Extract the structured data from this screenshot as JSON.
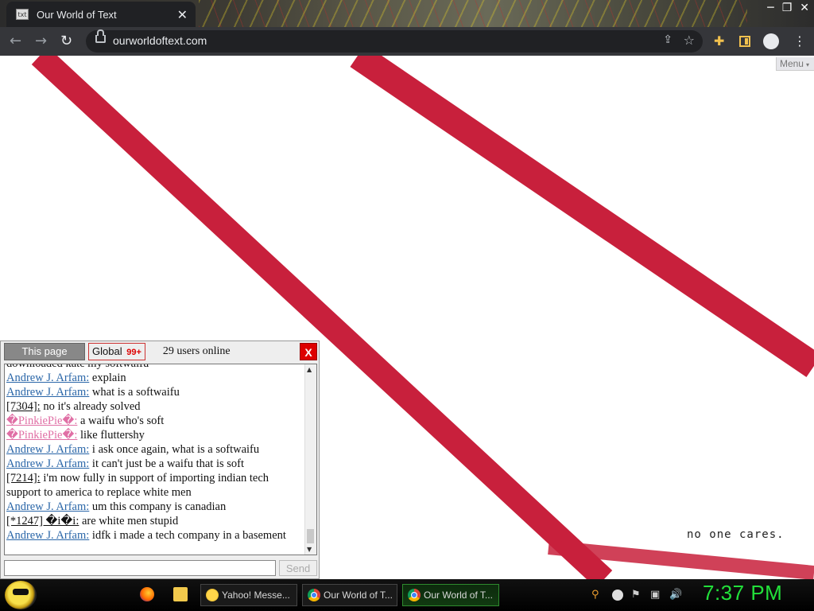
{
  "browser": {
    "tab_title": "Our World of Text",
    "favicon_text": "txt",
    "tab_close": "✕",
    "url": "ourworldoftext.com",
    "window_controls": [
      "─",
      "❐",
      "✕"
    ],
    "icons": [
      "back-icon",
      "forward-icon",
      "reload-icon",
      "lock-icon",
      "share-icon",
      "star-icon",
      "extensions-icon",
      "side-panel-icon",
      "profile-icon",
      "kebab-menu-icon"
    ]
  },
  "page": {
    "menu_label": "Menu",
    "menu_caret": "▾",
    "world_text": "no one cares."
  },
  "chat": {
    "tab_page": "This page",
    "tab_global": "Global",
    "global_badge": "99+",
    "users_online": "29 users online",
    "close_label": "X",
    "send_label": "Send",
    "input_value": "",
    "messages": [
      {
        "nick": "",
        "text": "downloaded kate my softwaifu",
        "nick_color": "black"
      },
      {
        "nick": "Andrew J. Arfam:",
        "text": "explain",
        "nick_color": "blue"
      },
      {
        "nick": "Andrew J. Arfam:",
        "text": "what is a softwaifu",
        "nick_color": "blue"
      },
      {
        "nick": "[7304]:",
        "text": "no it's already solved",
        "nick_color": "black"
      },
      {
        "nick": "�PinkiePie�:",
        "text": "a waifu who's soft",
        "nick_color": "pink"
      },
      {
        "nick": "�PinkiePie�:",
        "text": "like fluttershy",
        "nick_color": "pink"
      },
      {
        "nick": "Andrew J. Arfam:",
        "text": "i ask once again, what is a softwaifu",
        "nick_color": "blue"
      },
      {
        "nick": "Andrew J. Arfam:",
        "text": "it can't just be a waifu that is soft",
        "nick_color": "blue"
      },
      {
        "nick": "[7214]:",
        "text": "i'm now fully in support of importing indian tech support to america to replace white men",
        "nick_color": "black"
      },
      {
        "nick": "Andrew J. Arfam:",
        "text": "um this company is canadian",
        "nick_color": "blue"
      },
      {
        "nick": "[*1247] �i�i:",
        "text": "are white men stupid",
        "nick_color": "black"
      },
      {
        "nick": "Andrew J. Arfam:",
        "text": "idfk i made a tech company in a basement",
        "nick_color": "blue"
      }
    ]
  },
  "taskbar": {
    "tasks": [
      {
        "label": "Yahoo! Messe..."
      },
      {
        "label": "Our World of T..."
      },
      {
        "label": "Our World of T..."
      }
    ],
    "clock": "7:37 PM"
  },
  "colors": {
    "stripe_red": "#c8203c",
    "clock_green": "#22e03a",
    "chat_link_blue": "#2a66a8",
    "chat_pink": "#e06fa5",
    "close_red": "#dd0000"
  }
}
